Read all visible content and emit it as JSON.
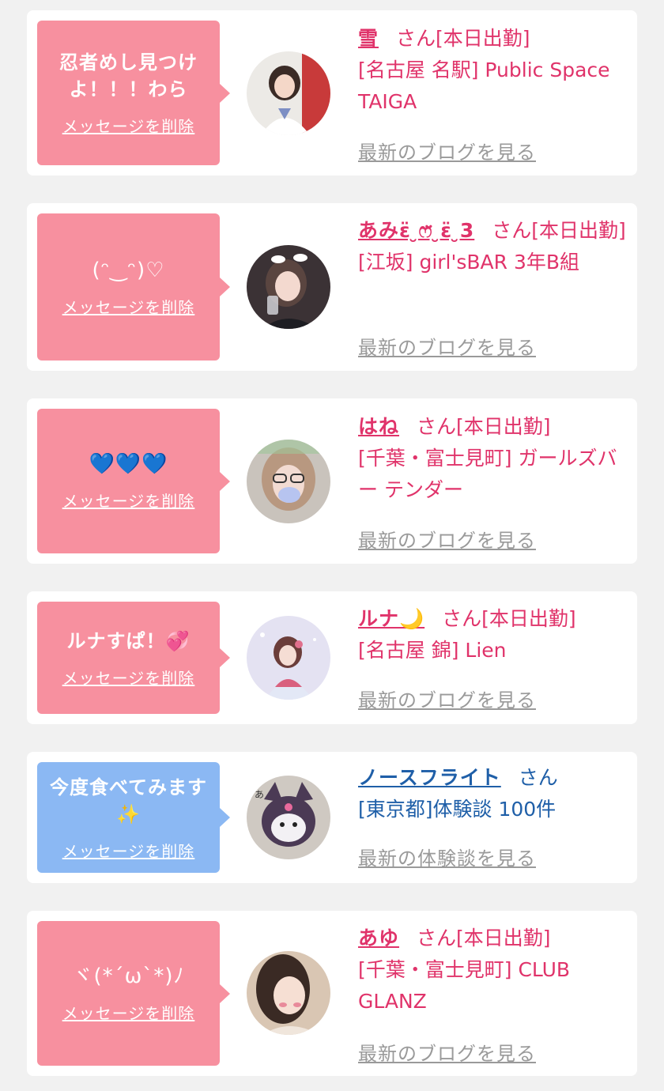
{
  "delete_label": "メッセージを削除",
  "cards": [
    {
      "message": "忍者めし見つけよ！！！わら",
      "name": "雪",
      "san": "さん[本日出勤]",
      "location": "[名古屋 名駅] Public Space TAIGA",
      "link": "最新のブログを見る",
      "theme": "pink"
    },
    {
      "message": "(ᵔ‿ᵔ)♡",
      "name": "あみɛ̈ ̮ෆ̈ ̮ɛ̈ ̮3",
      "san": "さん[本日出勤]",
      "location": "[江坂] girl'sBAR 3年B組",
      "link": "最新のブログを見る",
      "theme": "pink"
    },
    {
      "message": "💙💙💙",
      "name": "はね",
      "san": "さん[本日出勤]",
      "location": "[千葉・富士見町] ガールズバー テンダー",
      "link": "最新のブログを見る",
      "theme": "pink"
    },
    {
      "message": "ルナすぱ！💞",
      "name": "ルナ🌙",
      "san": "さん[本日出勤]",
      "location": "[名古屋 錦] Lien",
      "link": "最新のブログを見る",
      "theme": "pink"
    },
    {
      "message": "今度食べてみます✨",
      "name": "ノースフライト",
      "san": "さん",
      "location": "[東京都]体験談 100件",
      "link": "最新の体験談を見る",
      "theme": "blue"
    },
    {
      "message": "ヾ(*´ω`*)ﾉ",
      "name": "あゆ",
      "san": "さん[本日出勤]",
      "location": "[千葉・富士見町] CLUB GLANZ",
      "link": "最新のブログを見る",
      "theme": "pink"
    }
  ],
  "colors": {
    "pink_bubble": "#f7909f",
    "blue_bubble": "#8bb8f3",
    "pink_text": "#e0336a",
    "blue_text": "#1f5fa8",
    "link_gray": "#9a9a9a"
  }
}
